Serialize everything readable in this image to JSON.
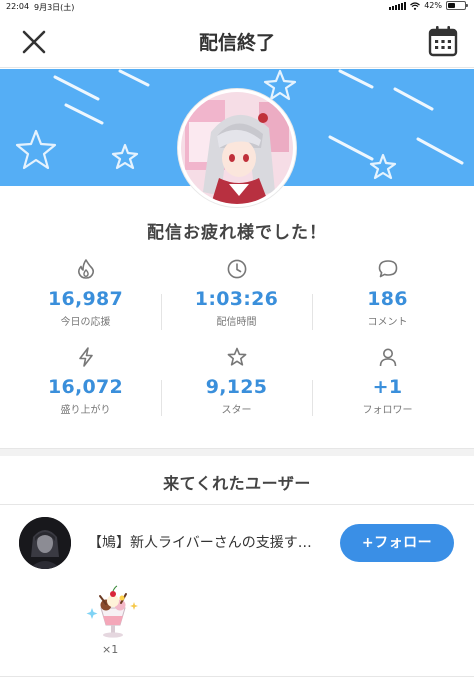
{
  "status_bar": {
    "time": "22:04",
    "date": "9月3日(土)",
    "battery": "42%",
    "battery_level": 0.42
  },
  "header": {
    "title": "配信終了",
    "close_icon": "close-icon",
    "calendar_icon": "calendar-icon"
  },
  "banner": {
    "color": "#55aef5"
  },
  "message": "配信お疲れ様でした！",
  "stats": [
    {
      "icon": "flame-icon",
      "value": "16,987",
      "label": "今日の応援"
    },
    {
      "icon": "clock-icon",
      "value": "1:03:26",
      "label": "配信時間"
    },
    {
      "icon": "comment-icon",
      "value": "186",
      "label": "コメント"
    },
    {
      "icon": "lightning-icon",
      "value": "16,072",
      "label": "盛り上がり"
    },
    {
      "icon": "star-icon",
      "value": "9,125",
      "label": "スター"
    },
    {
      "icon": "person-icon",
      "value": "+1",
      "label": "フォロワー"
    }
  ],
  "visitors": {
    "title": "来てくれたユーザー",
    "users": [
      {
        "name": "【鳩】新人ライバーさんの支援す…",
        "follow_label": "+フォロー",
        "gift_count": "×1"
      }
    ]
  },
  "colors": {
    "accent": "#3a8fe6",
    "stat_value": "#3a8fdb",
    "banner": "#55aef5"
  }
}
